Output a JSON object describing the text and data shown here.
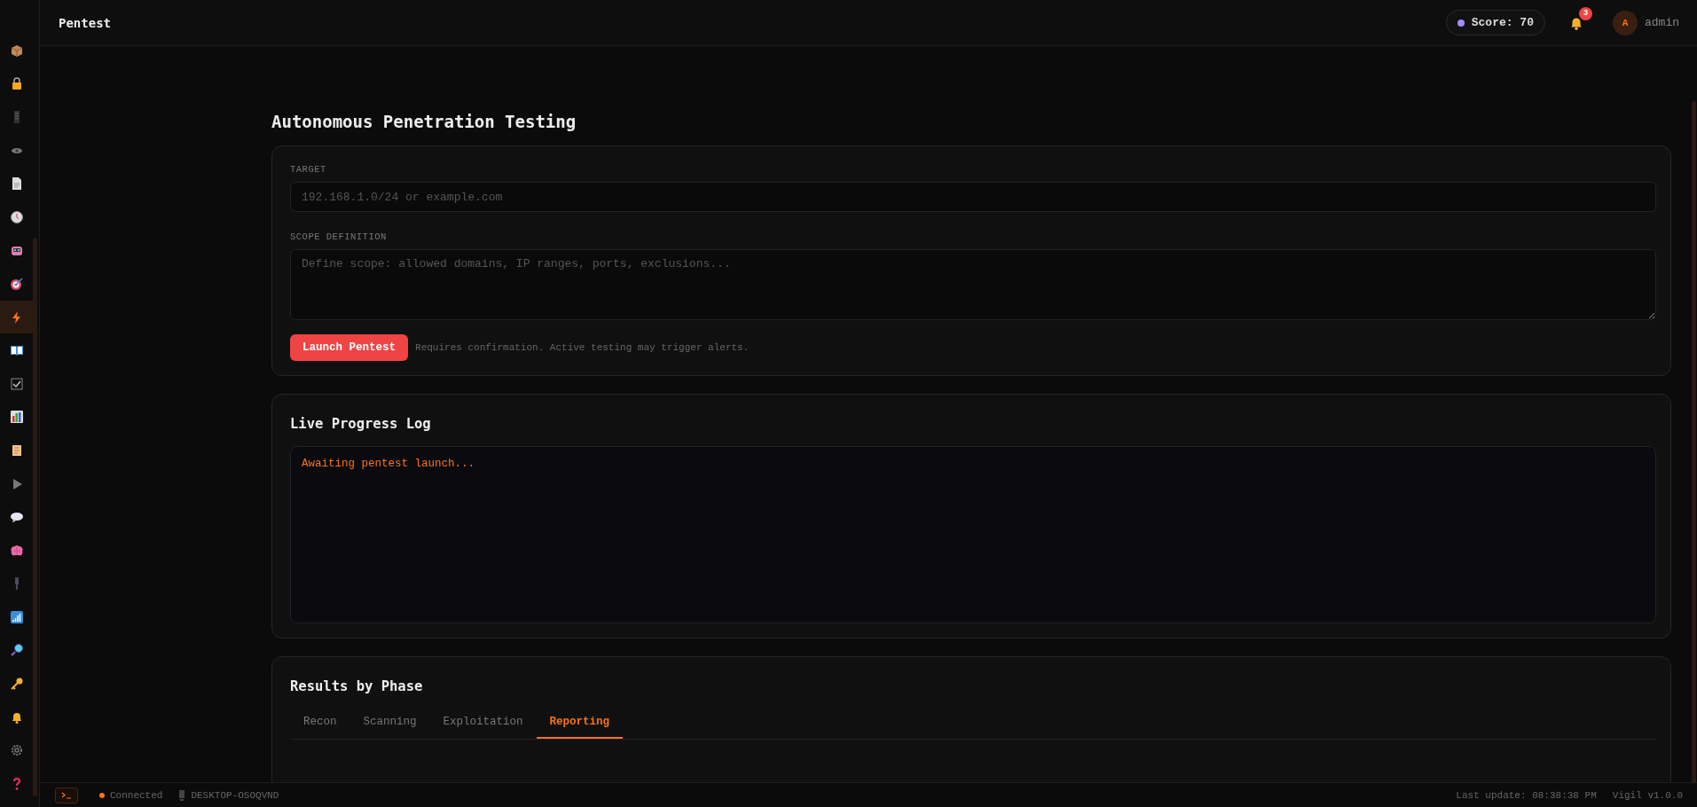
{
  "sidebar": {
    "items": [
      {
        "kind": "box",
        "selected": false
      },
      {
        "kind": "lock",
        "selected": false
      },
      {
        "kind": "server",
        "selected": false
      },
      {
        "kind": "eye",
        "selected": false
      },
      {
        "kind": "document",
        "selected": false
      },
      {
        "kind": "clock",
        "selected": false
      },
      {
        "kind": "robot",
        "selected": false
      },
      {
        "kind": "target",
        "selected": false
      },
      {
        "kind": "bolt",
        "selected": true
      },
      {
        "kind": "book",
        "selected": false
      },
      {
        "kind": "checkbox",
        "selected": false
      },
      {
        "kind": "chart",
        "selected": false
      },
      {
        "kind": "scroll",
        "selected": false
      },
      {
        "kind": "play",
        "selected": false
      },
      {
        "kind": "speech",
        "selected": false
      },
      {
        "kind": "brain",
        "selected": false
      },
      {
        "kind": "plug",
        "selected": false
      },
      {
        "kind": "signal",
        "selected": false
      },
      {
        "kind": "search",
        "selected": false
      },
      {
        "kind": "key",
        "selected": false
      },
      {
        "kind": "bell",
        "selected": false
      },
      {
        "kind": "gear",
        "selected": false
      },
      {
        "kind": "help",
        "selected": false
      }
    ]
  },
  "header": {
    "title": "Pentest",
    "score": "Score: 70",
    "notifications": "3",
    "avatar": "A",
    "user": "admin"
  },
  "page": {
    "title": "Autonomous Penetration Testing"
  },
  "form": {
    "target_label": "TARGET",
    "target_placeholder": "192.168.1.0/24 or example.com",
    "scope_label": "SCOPE DEFINITION",
    "scope_placeholder": "Define scope: allowed domains, IP ranges, ports, exclusions...",
    "launch": "Launch Pentest",
    "note": "Requires confirmation. Active testing may trigger alerts."
  },
  "log": {
    "title": "Live Progress Log",
    "lines": [
      "Awaiting pentest launch..."
    ]
  },
  "results": {
    "title": "Results by Phase",
    "tabs": [
      {
        "label": "Recon",
        "selected": false
      },
      {
        "label": "Scanning",
        "selected": false
      },
      {
        "label": "Exploitation",
        "selected": false
      },
      {
        "label": "Reporting",
        "selected": true
      }
    ]
  },
  "status_bar": {
    "connection": "Connected",
    "host": "DESKTOP-OSOQVND",
    "last_update": "Last update: 08:38:38 PM",
    "version": "Vigil v1.0.0"
  }
}
